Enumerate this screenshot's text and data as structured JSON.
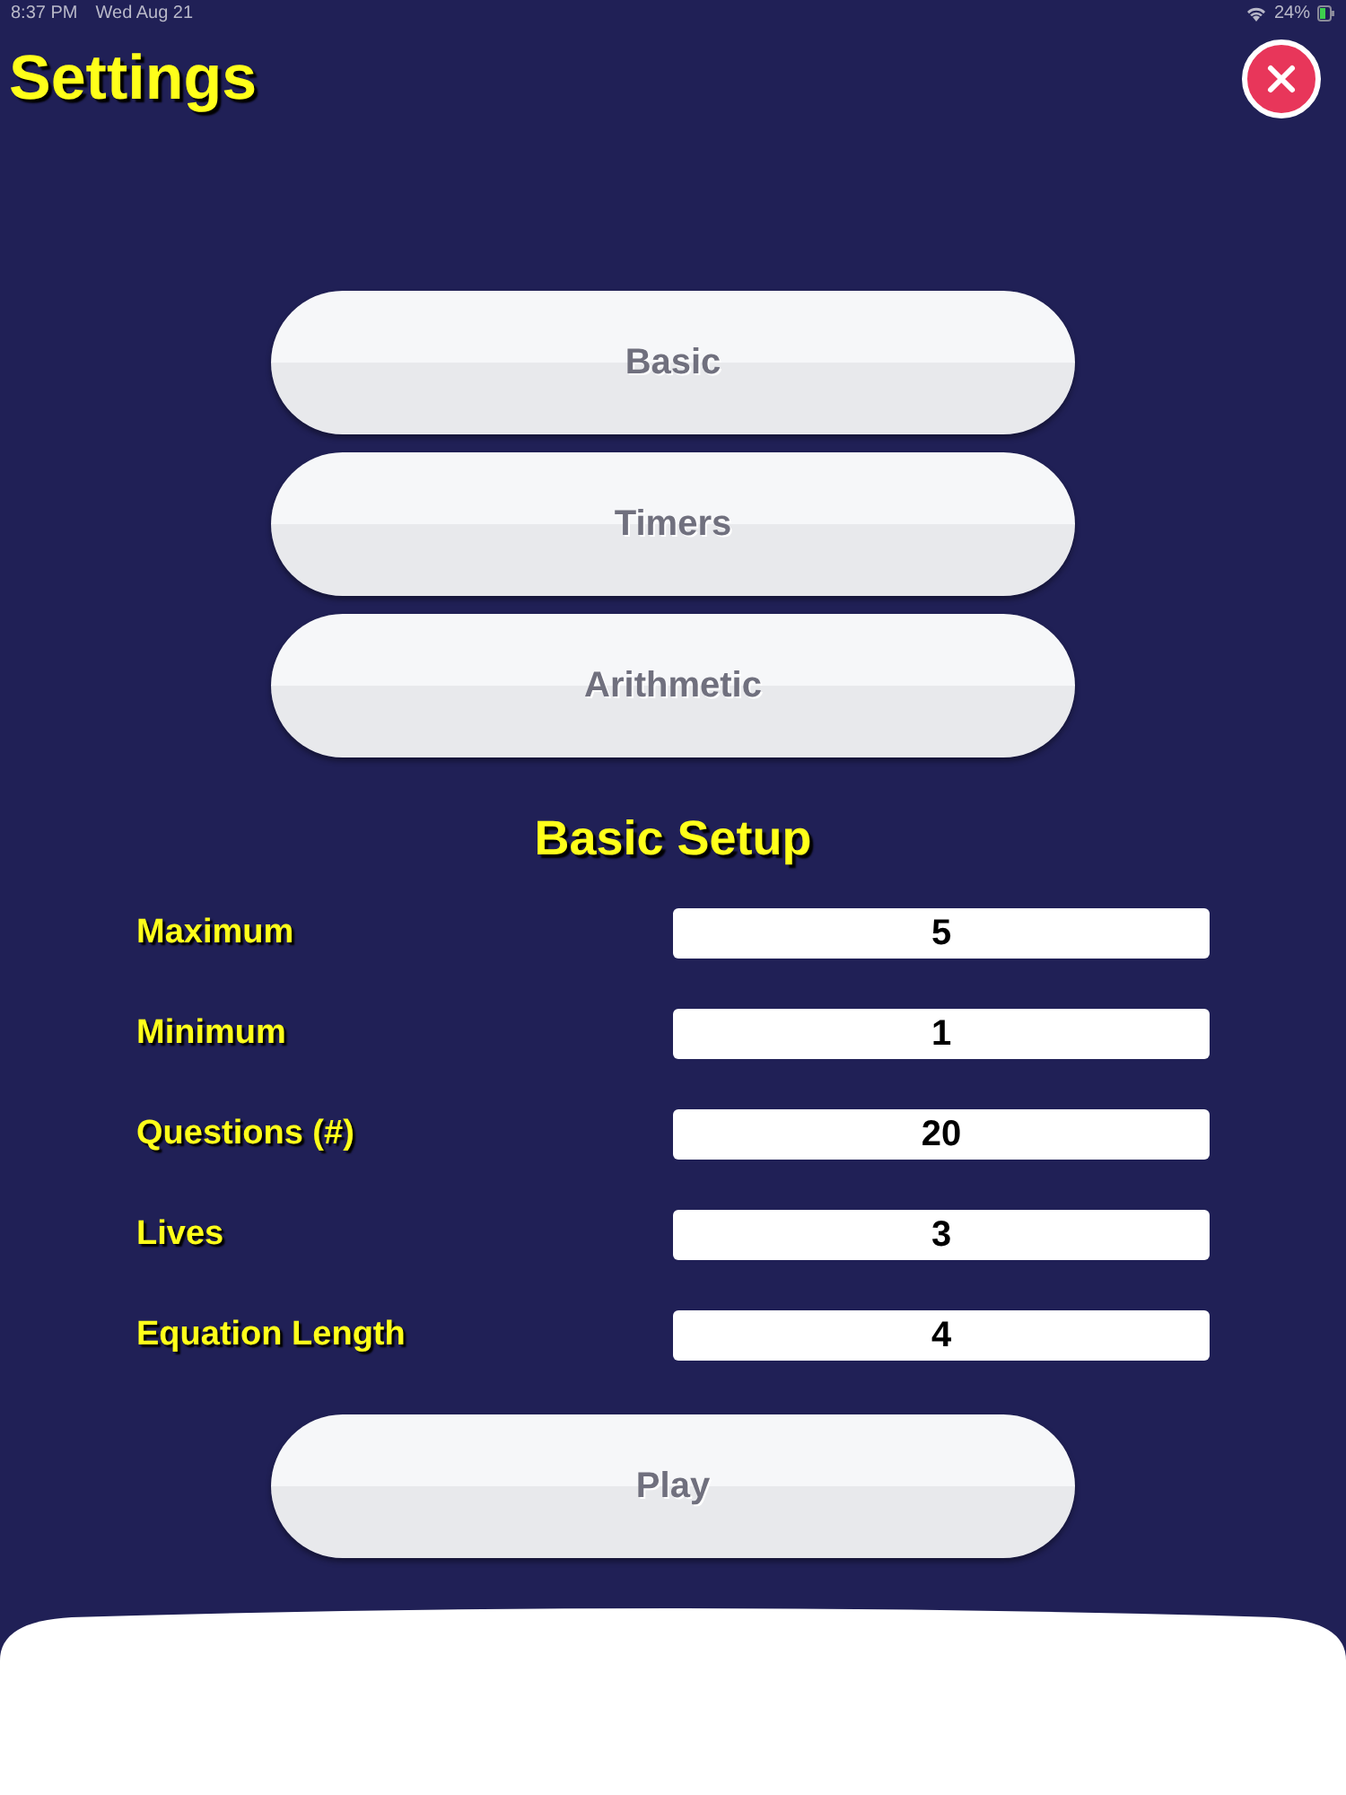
{
  "status_bar": {
    "time": "8:37 PM",
    "date": "Wed Aug 21",
    "battery": "24%"
  },
  "title": "Settings",
  "menu_buttons": [
    "Basic",
    "Timers",
    "Arithmetic"
  ],
  "section_title": "Basic Setup",
  "fields": [
    {
      "label": "Maximum",
      "value": "5"
    },
    {
      "label": "Minimum",
      "value": "1"
    },
    {
      "label": "Questions (#)",
      "value": "20"
    },
    {
      "label": "Lives",
      "value": "3"
    },
    {
      "label": "Equation Length",
      "value": "4"
    }
  ],
  "play_button": "Play"
}
